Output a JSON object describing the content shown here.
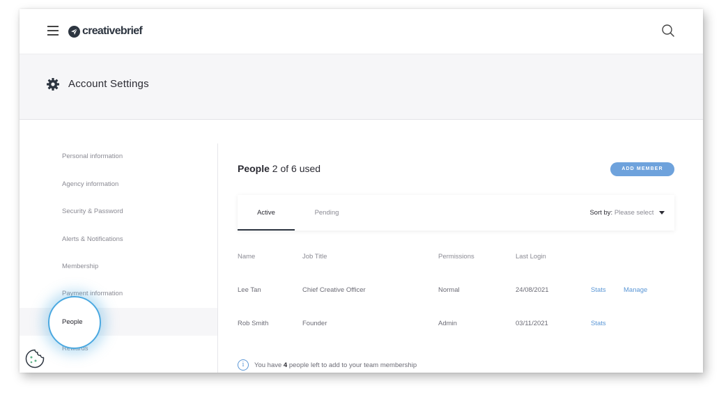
{
  "brand": {
    "name": "creativebrief"
  },
  "header": {
    "title": "Account Settings"
  },
  "sidebar": {
    "items": [
      {
        "label": "Personal information"
      },
      {
        "label": "Agency information"
      },
      {
        "label": "Security & Password"
      },
      {
        "label": "Alerts & Notifications"
      },
      {
        "label": "Membership"
      },
      {
        "label": "Payment information"
      },
      {
        "label": "People"
      },
      {
        "label": "Rewards"
      }
    ]
  },
  "people": {
    "title_bold": "People",
    "title_rest": " 2 of 6 used",
    "add_button": "ADD MEMBER",
    "tabs": {
      "active": "Active",
      "pending": "Pending"
    },
    "sort": {
      "label": "Sort by:",
      "value": "Please select"
    },
    "columns": [
      "Name",
      "Job Title",
      "Permissions",
      "Last Login"
    ],
    "rows": [
      {
        "name": "Lee Tan",
        "job": "Chief Creative Officer",
        "perm": "Normal",
        "last": "24/08/2021",
        "stats": "Stats",
        "manage": "Manage"
      },
      {
        "name": "Rob Smith",
        "job": "Founder",
        "perm": "Admin",
        "last": "03/11/2021",
        "stats": "Stats"
      }
    ],
    "info": {
      "prefix": "You have ",
      "count": "4",
      "suffix": " people left to add to your team membership"
    }
  },
  "colors": {
    "accent": "#6ea2dc",
    "link": "#5b97d6",
    "highlight": "#4aa8e0",
    "dark": "#2d3540"
  }
}
